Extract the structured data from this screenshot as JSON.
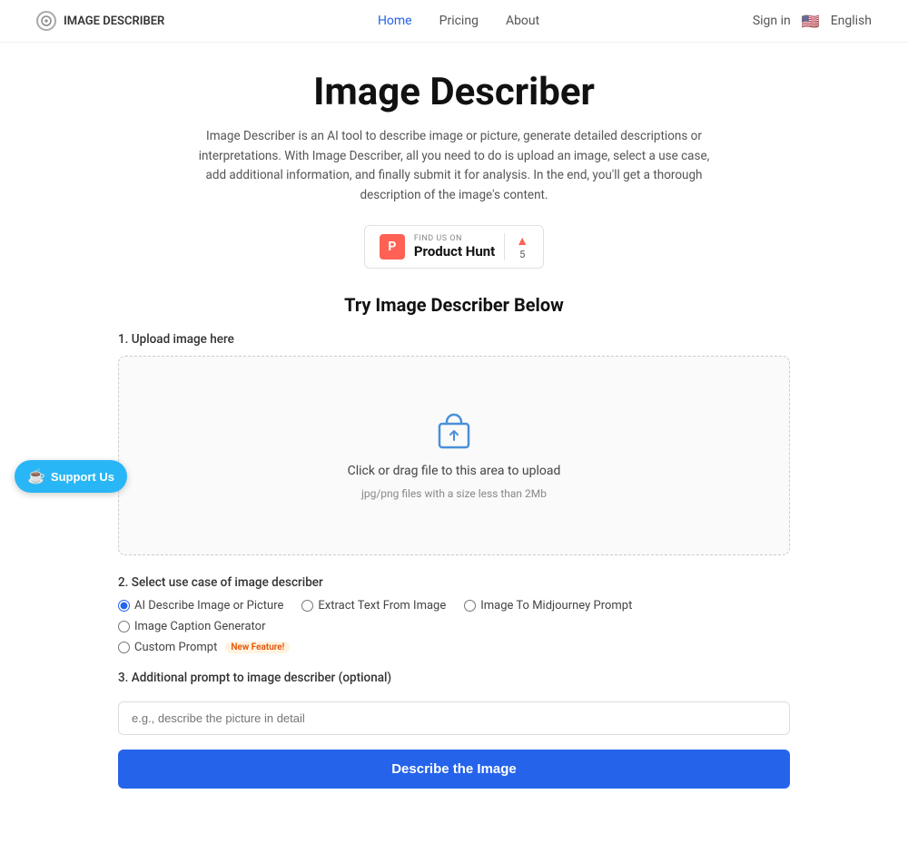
{
  "nav": {
    "logo_text": "IMAGE DESCRIBER",
    "links": [
      {
        "label": "Home",
        "active": true
      },
      {
        "label": "Pricing",
        "active": false
      },
      {
        "label": "About",
        "active": false
      }
    ],
    "sign_in": "Sign in",
    "language": "English",
    "flag": "🇺🇸"
  },
  "hero": {
    "title": "Image Describer",
    "subtitle": "Image Describer is an AI tool to describe image or picture, generate detailed descriptions or interpretations. With Image Describer, all you need to do is upload an image, select a use case, add additional information, and finally submit it for analysis. In the end, you'll get a thorough description of the image's content.",
    "ph_find": "FIND US ON",
    "ph_name": "Product Hunt",
    "ph_score_arrow": "▲",
    "ph_score_number": "5"
  },
  "try_section": {
    "title": "Try Image Describer Below",
    "upload_label": "1. Upload image here",
    "upload_main": "Click or drag file to this area to upload",
    "upload_sub": "jpg/png files with a size less than 2Mb",
    "use_case_label": "2. Select use case of image describer",
    "radio_options": [
      {
        "id": "ai_describe",
        "label": "AI Describe Image or Picture",
        "checked": true,
        "new": false
      },
      {
        "id": "extract_text",
        "label": "Extract Text From Image",
        "checked": false,
        "new": false
      },
      {
        "id": "midjourney",
        "label": "Image To Midjourney Prompt",
        "checked": false,
        "new": false
      },
      {
        "id": "caption",
        "label": "Image Caption Generator",
        "checked": false,
        "new": false
      },
      {
        "id": "custom",
        "label": "Custom Prompt",
        "checked": false,
        "new": true
      }
    ],
    "new_feature_label": "New Feature!",
    "prompt_label": "3. Additional prompt to image describer (optional)",
    "prompt_placeholder": "e.g., describe the picture in detail",
    "submit_label": "Describe the Image"
  },
  "support": {
    "label": "Support Us"
  }
}
